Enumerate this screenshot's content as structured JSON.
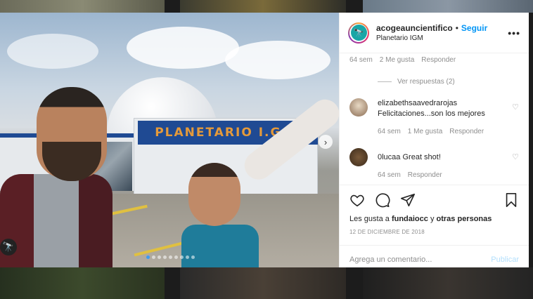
{
  "post": {
    "username": "acogeauncientifico",
    "follow_label": "Seguir",
    "separator": "•",
    "location": "Planetario IGM",
    "more_label": "•••",
    "photo_sign_text": "PLANETARIO I.G.M",
    "carousel": {
      "total": 9,
      "active_index": 0
    }
  },
  "comments": {
    "first_meta": {
      "time": "64 sem",
      "likes": "2 Me gusta",
      "reply": "Responder"
    },
    "view_replies": "Ver respuestas (2)",
    "items": [
      {
        "username": "elizabethsaavedrarojas",
        "text": "Felicitaciones...son los mejores",
        "time": "64 sem",
        "likes": "1 Me gusta",
        "reply": "Responder"
      },
      {
        "username": "0lucaa",
        "text": "Great shot!",
        "time": "64 sem",
        "reply": "Responder"
      }
    ]
  },
  "actions": {
    "likes_prefix": "Les gusta a",
    "likes_user": "fundaiocc",
    "likes_join": "y",
    "likes_others": "otras personas",
    "date": "12 DE DICIEMBRE DE 2018"
  },
  "add_comment": {
    "placeholder": "Agrega un comentario...",
    "publish_label": "Publicar"
  },
  "colors": {
    "accent": "#0095f6",
    "publish_disabled": "#b2dffc",
    "sign_bg": "#1f4a93",
    "sign_text": "#e59a3a"
  }
}
